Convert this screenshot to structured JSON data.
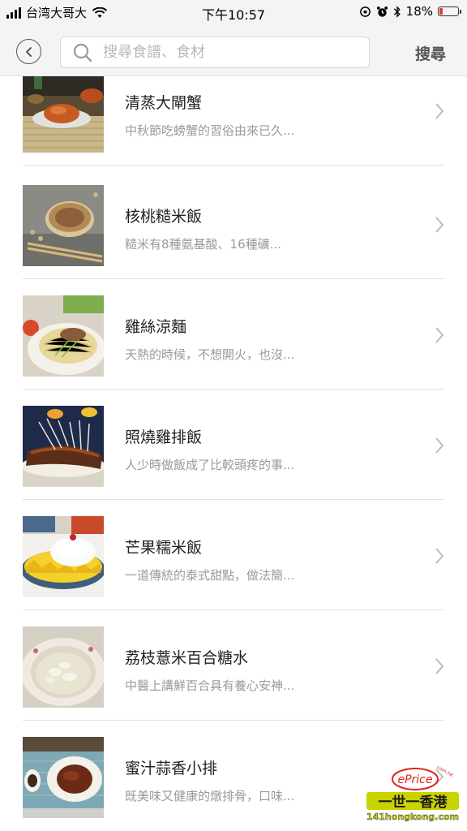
{
  "status_bar": {
    "carrier": "台湾大哥大",
    "time": "下午10:57",
    "battery": "18%",
    "battery_level": 0.18
  },
  "header": {
    "search_placeholder": "搜尋食譜、食材",
    "search_button": "搜尋"
  },
  "recipes": [
    {
      "title": "清蒸大閘蟹",
      "description": "中秋節吃螃蟹的習俗由來已久..."
    },
    {
      "title": "核桃糙米飯",
      "description": "糙米有8種氨基酸、16種礦..."
    },
    {
      "title": "雞絲涼麵",
      "description": "天熱的時候，不想開火，也沒..."
    },
    {
      "title": "照燒雞排飯",
      "description": "人少時做飯成了比較頭疼的事..."
    },
    {
      "title": "芒果糯米飯",
      "description": "一道傳統的泰式甜點，做法簡..."
    },
    {
      "title": "荔枝薏米百合糖水",
      "description": "中醫上講鮮百合具有養心安神..."
    },
    {
      "title": "蜜汁蒜香小排",
      "description": "既美味又健康的燉排骨，口味..."
    }
  ],
  "watermark": {
    "brand": "ePrice",
    "domain": "com.hk",
    "slogan": "一世一香港",
    "site": "141hongkong.com"
  },
  "colors": {
    "accent": "#c9d300",
    "watermark_red": "#e2231a",
    "battery_low": "#e53935"
  }
}
